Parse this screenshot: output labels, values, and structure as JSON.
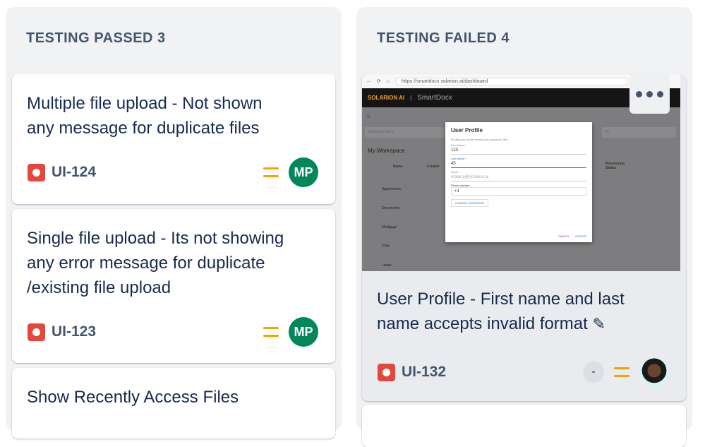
{
  "columns": [
    {
      "title": "TESTING PASSED 3",
      "cards": [
        {
          "title": "Multiple file upload - Not shown any message for duplicate files",
          "key": "UI-124",
          "assignee": "MP"
        },
        {
          "title": "Single file upload - Its not showing any error message for duplicate /existing file upload",
          "key": "UI-123",
          "assignee": "MP"
        },
        {
          "title": "Show Recently Access Files"
        }
      ]
    },
    {
      "title": "TESTING FAILED 4",
      "cards": [
        {
          "title": "User Profile - First name and last name accepts invalid format",
          "key": "UI-132",
          "estimate": "-",
          "assignee": "avatar-photo",
          "thumbnail": {
            "url": "https://smartdocx.solarion.ai/dashboard",
            "brand": "SOLARION AI",
            "app": "SmartDocx",
            "search": "Search by Name",
            "filter": "All",
            "workspace": "My Workspace",
            "dialog": {
              "title": "User Profile",
              "subtitle": "Modify your profile details and password here.",
              "first_name_label": "First Name *",
              "first_name": "123",
              "last_name_label": "Last Name *",
              "last_name": "45",
              "email_label": "Email *",
              "email": "malar.p@solarion.ai",
              "phone_label": "Phone number",
              "phone": "+1",
              "change_password": "CHANGE PASSWORD",
              "cancel": "CANCEL",
              "update": "UPDATE"
            },
            "columns": [
              "Name",
              "Creator",
              "Processing Status"
            ],
            "rows": [
              "Agreements",
              "Documents",
              "Mortgage",
              "CRA",
              "Lease"
            ]
          }
        }
      ]
    }
  ],
  "colors": {
    "bug": "#e2483d",
    "priority_medium": "#f5a300",
    "avatar": "#00875a"
  }
}
